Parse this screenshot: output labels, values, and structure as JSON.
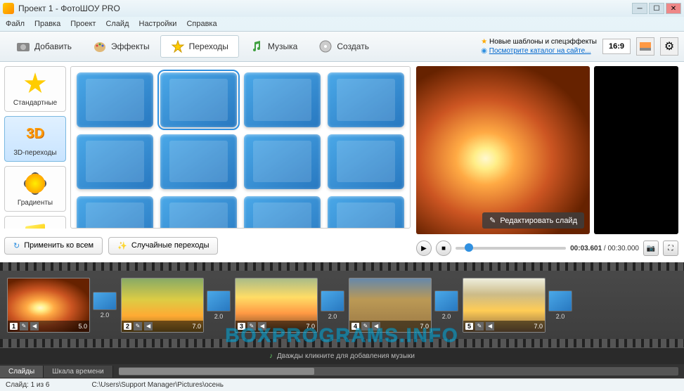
{
  "window": {
    "title": "Проект 1 - ФотоШОУ PRO"
  },
  "menu": {
    "file": "Файл",
    "edit": "Правка",
    "project": "Проект",
    "slide": "Слайд",
    "settings": "Настройки",
    "help": "Справка"
  },
  "toolbar": {
    "add": "Добавить",
    "effects": "Эффекты",
    "transitions": "Переходы",
    "music": "Музыка",
    "create": "Создать",
    "promo1": "Новые шаблоны и спецэффекты",
    "promo2": "Посмотрите каталог на сайте...",
    "aspect": "16:9"
  },
  "categories": {
    "standard": "Стандартные",
    "threeD": "3D-переходы",
    "gradients": "Градиенты"
  },
  "actions": {
    "applyAll": "Применить ко всем",
    "random": "Случайные переходы",
    "editSlide": "Редактировать слайд"
  },
  "playback": {
    "current": "00:03.601",
    "total": "00:30.000"
  },
  "timeline": {
    "slides": [
      {
        "num": "1",
        "dur": "5.0",
        "trans": "2.0"
      },
      {
        "num": "2",
        "dur": "7.0",
        "trans": "2.0"
      },
      {
        "num": "3",
        "dur": "7.0",
        "trans": "2.0"
      },
      {
        "num": "4",
        "dur": "7.0",
        "trans": "2.0"
      },
      {
        "num": "5",
        "dur": "7.0",
        "trans": "2.0"
      }
    ],
    "musicHint": "Дважды кликните для добавления музыки",
    "tabSlides": "Слайды",
    "tabTime": "Шкала времени"
  },
  "status": {
    "slideCount": "Слайд: 1 из 6",
    "path": "C:\\Users\\Support Manager\\Pictures\\осень"
  },
  "watermark": "BOXPROGRAMS.INFO"
}
